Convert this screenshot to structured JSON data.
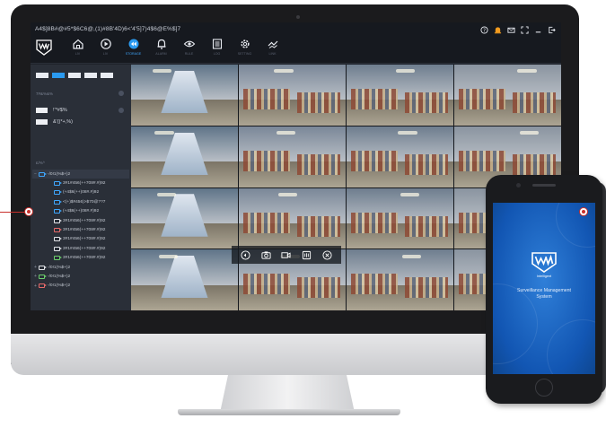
{
  "app": {
    "title": "A4$]8B#@#5*$6C6@,(1)#8B'4D)6<'4'5]7)4$6@E%$]7"
  },
  "nav": {
    "items": [
      {
        "label": "LIV",
        "icon": "home-icon",
        "active": false
      },
      {
        "label": "LIV",
        "icon": "play-icon",
        "active": false
      },
      {
        "label": "STORAGE",
        "icon": "rewind-icon",
        "active": true
      },
      {
        "label": "ALARM",
        "icon": "bell-icon",
        "active": false
      },
      {
        "label": "RULE",
        "icon": "eye-icon",
        "active": false
      },
      {
        "label": "LOG",
        "icon": "list-icon",
        "active": false
      },
      {
        "label": "SETTING",
        "icon": "gear-icon",
        "active": false
      },
      {
        "label": "LINK",
        "icon": "hand-icon",
        "active": false
      }
    ]
  },
  "window_controls": [
    "help-icon",
    "alarm-icon",
    "message-icon",
    "fullscreen-icon",
    "minimize-icon",
    "exit-icon"
  ],
  "sidebar": {
    "view_buttons": 5,
    "active_view": 1,
    "section1": "7#&%&%",
    "options": [
      "!'*#$%",
      "&'()*+,%)"
    ],
    "section2": "£/%^",
    "tree": [
      {
        "type": "group",
        "label": "-/0!1(%$+)2",
        "color": "#3fa8ff",
        "expanded": true
      },
      {
        "type": "child",
        "label": "3#1#456(++708#.#)92",
        "color": "#3fa8ff"
      },
      {
        "type": "child",
        "label": "(+4$6(++)08#.#)92",
        "color": "#3fa8ff"
      },
      {
        "type": "child",
        "label": "<(+)$#456)>$70@??7",
        "color": "#3fa8ff"
      },
      {
        "type": "child",
        "label": "(+4$6(++)08#.#)92",
        "color": "#3fa8ff"
      },
      {
        "type": "child",
        "label": "3#1#456(++708#.#)92",
        "color": "#e4e6ea"
      },
      {
        "type": "child",
        "label": "3#1#456(++708#.#)92",
        "color": "#e86a6a"
      },
      {
        "type": "child",
        "label": "3#1#456(++708#.#)92",
        "color": "#e4e6ea"
      },
      {
        "type": "child",
        "label": "3#1#456(++708#.#)92",
        "color": "#e4e6ea"
      },
      {
        "type": "child",
        "label": "3#1#456(++708#.#)92",
        "color": "#6ccf6c"
      },
      {
        "type": "group",
        "label": "-/0!1(%$+)2",
        "color": "#e4e6ea",
        "expanded": false
      },
      {
        "type": "group",
        "label": "-/0!1(%$+)2",
        "color": "#6ccf6c",
        "expanded": false
      },
      {
        "type": "group",
        "label": "-/0!1(%$+)2",
        "color": "#e86a6a",
        "expanded": false
      }
    ]
  },
  "ptz_toolbar": [
    "record-back-icon",
    "camera-icon",
    "video-icon",
    "stream-icon",
    "close-icon"
  ],
  "phone": {
    "brand": "Intelligent",
    "caption": "Surveillance Management System"
  },
  "colors": {
    "accent": "#2a9af0",
    "connector": "#c9302c",
    "phone_bg": "#1256b3"
  }
}
